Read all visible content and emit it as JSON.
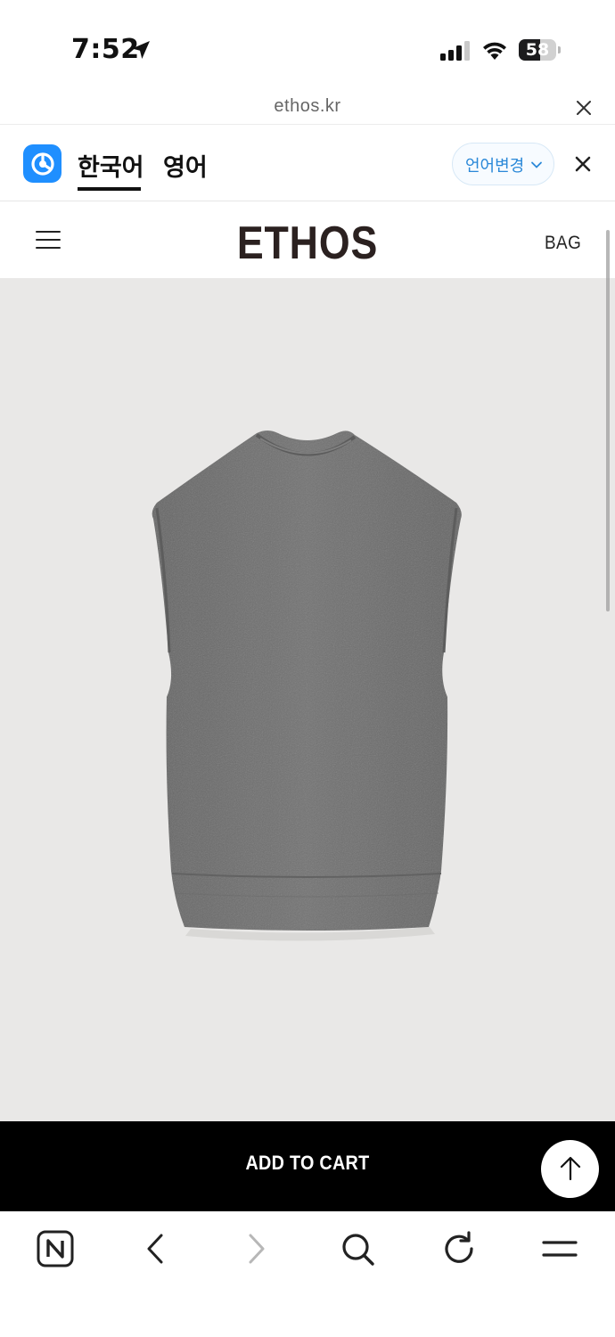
{
  "status_bar": {
    "time": "7:52",
    "battery_level": "58",
    "battery_fraction": 0.58
  },
  "browser": {
    "url": "ethos.kr"
  },
  "translate_bar": {
    "tabs": [
      {
        "label": "한국어",
        "active": true
      },
      {
        "label": "영어",
        "active": false
      }
    ],
    "change_language_label": "언어변경",
    "accent_color": "#1f8fff"
  },
  "site_header": {
    "logo": "ETHOS",
    "bag_label": "BAG"
  },
  "product": {
    "image_subject": "gray knit sleeveless mock-neck vest",
    "background_color": "#e9e8e7",
    "garment_color": "#6f6f6f"
  },
  "cart": {
    "add_to_cart_label": "ADD TO CART"
  },
  "icons": {
    "status": [
      "location-arrow-icon",
      "cellular-signal-icon",
      "wifi-icon",
      "battery-icon"
    ],
    "toolbar": [
      "naver-n-icon",
      "back-icon",
      "forward-icon",
      "search-icon",
      "reload-icon",
      "menu-icon"
    ]
  }
}
